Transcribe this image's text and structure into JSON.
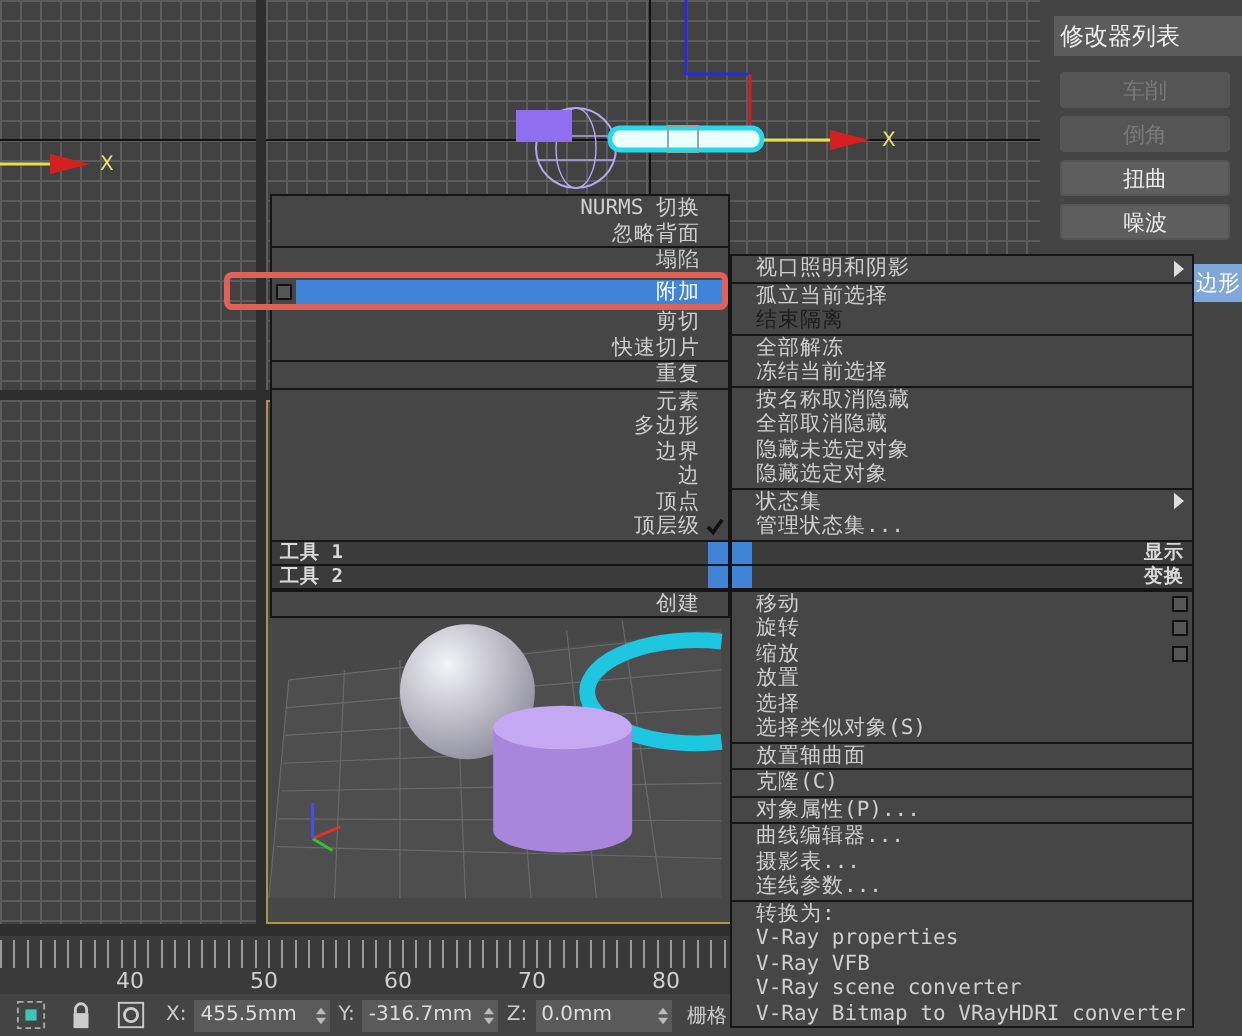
{
  "viewports": {
    "top_left": {
      "axis_label": "X"
    },
    "top_right": {
      "axis_label": "X"
    }
  },
  "command_panel": {
    "modifier_list": "修改器列表",
    "buttons": [
      {
        "label": "车削",
        "disabled": true
      },
      {
        "label": "倒角",
        "disabled": true
      },
      {
        "label": "扭曲",
        "disabled": false
      },
      {
        "label": "噪波",
        "disabled": false
      }
    ],
    "stack_item": {
      "label": "边形",
      "selected": true
    }
  },
  "quad_menu": {
    "quadrants": [
      {
        "title": "工具 1",
        "groups": [
          [
            {
              "label": "NURMS 切换",
              "selected": false,
              "checked": false,
              "disabled": false,
              "options": false,
              "submenu": false
            },
            {
              "label": "忽略背面",
              "selected": false,
              "checked": false,
              "disabled": false,
              "options": false,
              "submenu": false
            }
          ],
          [
            {
              "label": "塌陷",
              "selected": false,
              "checked": false,
              "disabled": false,
              "options": false,
              "submenu": false
            },
            {
              "label": "附加",
              "selected": true,
              "checked": false,
              "disabled": false,
              "options": true,
              "submenu": false
            },
            {
              "label": "剪切",
              "selected": false,
              "checked": false,
              "disabled": false,
              "options": false,
              "submenu": false
            },
            {
              "label": "快速切片",
              "selected": false,
              "checked": false,
              "disabled": false,
              "options": false,
              "submenu": false
            }
          ],
          [
            {
              "label": "重复",
              "selected": false,
              "checked": false,
              "disabled": false,
              "options": false,
              "submenu": false
            }
          ],
          [
            {
              "label": "元素",
              "selected": false,
              "checked": false,
              "disabled": false,
              "options": false,
              "submenu": false
            },
            {
              "label": "多边形",
              "selected": false,
              "checked": false,
              "disabled": false,
              "options": false,
              "submenu": false
            },
            {
              "label": "边界",
              "selected": false,
              "checked": false,
              "disabled": false,
              "options": false,
              "submenu": false
            },
            {
              "label": "边",
              "selected": false,
              "checked": false,
              "disabled": false,
              "options": false,
              "submenu": false
            },
            {
              "label": "顶点",
              "selected": false,
              "checked": false,
              "disabled": false,
              "options": false,
              "submenu": false
            },
            {
              "label": "顶层级",
              "selected": false,
              "checked": true,
              "disabled": false,
              "options": false,
              "submenu": false
            }
          ]
        ]
      },
      {
        "title": "工具 2",
        "groups": [
          [
            {
              "label": "创建",
              "selected": false,
              "checked": false,
              "disabled": false,
              "options": false,
              "submenu": false
            }
          ]
        ]
      },
      {
        "title": "显示",
        "groups": [
          [
            {
              "label": "视口照明和阴影",
              "selected": false,
              "checked": false,
              "disabled": false,
              "options": false,
              "submenu": true
            }
          ],
          [
            {
              "label": "孤立当前选择",
              "selected": false,
              "checked": false,
              "disabled": false,
              "options": false,
              "submenu": false
            },
            {
              "label": "结束隔离",
              "selected": false,
              "checked": false,
              "disabled": true,
              "options": false,
              "submenu": false
            }
          ],
          [
            {
              "label": "全部解冻",
              "selected": false,
              "checked": false,
              "disabled": false,
              "options": false,
              "submenu": false
            },
            {
              "label": "冻结当前选择",
              "selected": false,
              "checked": false,
              "disabled": false,
              "options": false,
              "submenu": false
            }
          ],
          [
            {
              "label": "按名称取消隐藏",
              "selected": false,
              "checked": false,
              "disabled": false,
              "options": false,
              "submenu": false
            },
            {
              "label": "全部取消隐藏",
              "selected": false,
              "checked": false,
              "disabled": false,
              "options": false,
              "submenu": false
            },
            {
              "label": "隐藏未选定对象",
              "selected": false,
              "checked": false,
              "disabled": false,
              "options": false,
              "submenu": false
            },
            {
              "label": "隐藏选定对象",
              "selected": false,
              "checked": false,
              "disabled": false,
              "options": false,
              "submenu": false
            }
          ],
          [
            {
              "label": "状态集",
              "selected": false,
              "checked": false,
              "disabled": false,
              "options": false,
              "submenu": true
            },
            {
              "label": "管理状态集...",
              "selected": false,
              "checked": false,
              "disabled": false,
              "options": false,
              "submenu": false
            }
          ]
        ]
      },
      {
        "title": "变换",
        "groups": [
          [
            {
              "label": "移动",
              "selected": false,
              "checked": false,
              "disabled": false,
              "options": true,
              "submenu": false
            },
            {
              "label": "旋转",
              "selected": false,
              "checked": false,
              "disabled": false,
              "options": true,
              "submenu": false
            },
            {
              "label": "缩放",
              "selected": false,
              "checked": false,
              "disabled": false,
              "options": true,
              "submenu": false
            },
            {
              "label": "放置",
              "selected": false,
              "checked": false,
              "disabled": false,
              "options": false,
              "submenu": false
            },
            {
              "label": "选择",
              "selected": false,
              "checked": false,
              "disabled": false,
              "options": false,
              "submenu": false
            },
            {
              "label": "选择类似对象(S)",
              "selected": false,
              "checked": false,
              "disabled": false,
              "options": false,
              "submenu": false
            }
          ],
          [
            {
              "label": "放置轴曲面",
              "selected": false,
              "checked": false,
              "disabled": false,
              "options": false,
              "submenu": false
            }
          ],
          [
            {
              "label": "克隆(C)",
              "selected": false,
              "checked": false,
              "disabled": false,
              "options": false,
              "submenu": false
            }
          ],
          [
            {
              "label": "对象属性(P)...",
              "selected": false,
              "checked": false,
              "disabled": false,
              "options": false,
              "submenu": false
            }
          ],
          [
            {
              "label": "曲线编辑器...",
              "selected": false,
              "checked": false,
              "disabled": false,
              "options": false,
              "submenu": false
            },
            {
              "label": "摄影表...",
              "selected": false,
              "checked": false,
              "disabled": false,
              "options": false,
              "submenu": false
            },
            {
              "label": "连线参数...",
              "selected": false,
              "checked": false,
              "disabled": false,
              "options": false,
              "submenu": false
            }
          ],
          [
            {
              "label": "转换为:",
              "selected": false,
              "checked": false,
              "disabled": false,
              "options": false,
              "submenu": false
            },
            {
              "label": "V-Ray properties",
              "selected": false,
              "checked": false,
              "disabled": false,
              "options": false,
              "submenu": false
            },
            {
              "label": "V-Ray VFB",
              "selected": false,
              "checked": false,
              "disabled": false,
              "options": false,
              "submenu": false
            },
            {
              "label": "V-Ray scene converter",
              "selected": false,
              "checked": false,
              "disabled": false,
              "options": false,
              "submenu": false
            },
            {
              "label": "V-Ray Bitmap to VRayHDRI converter",
              "selected": false,
              "checked": false,
              "disabled": false,
              "options": false,
              "submenu": false
            }
          ]
        ]
      }
    ]
  },
  "annotation": {
    "highlight_frame": true
  },
  "timeline_ruler": {
    "labels": [
      "40",
      "50",
      "60",
      "70",
      "80"
    ]
  },
  "status_bar": {
    "coordinates": [
      {
        "axis": "X:",
        "value": "455.5mm"
      },
      {
        "axis": "Y:",
        "value": "-316.7mm"
      },
      {
        "axis": "Z:",
        "value": "0.0mm"
      }
    ],
    "grid_label": "栅格"
  }
}
